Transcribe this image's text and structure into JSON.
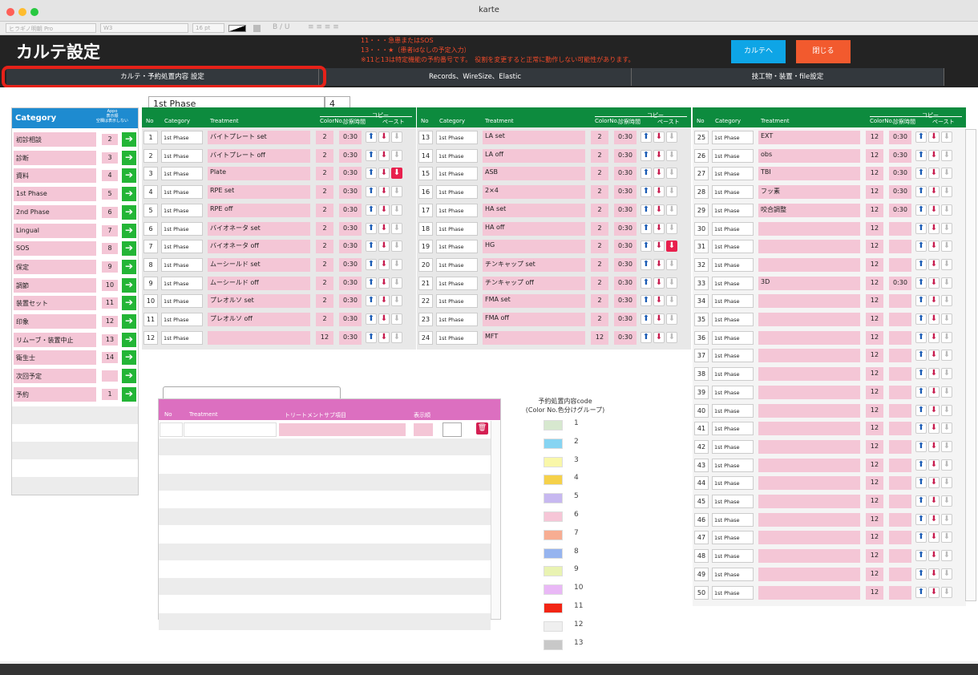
{
  "window": {
    "title": "karte"
  },
  "format_bar": {
    "font": "ヒラギノ明朝 Pro",
    "style": "W3",
    "size": "16 pt",
    "text_buttons": "B / U"
  },
  "header": {
    "title": "カルテ設定",
    "notes": [
      "11・・・急患またはSOS",
      "13・・・★（患者idなしの予定入力）",
      "※11と13は特定機能の予約番号です。　役割を変更すると正常に動作しない可能性があります。"
    ],
    "karte_button": "カルテへ",
    "close_button": "閉じる",
    "button_colors": {
      "karte": "#0ea5e6",
      "close": "#f25a2e"
    }
  },
  "tabs": [
    "カルテ・予約処置内容 設定",
    "Records、WireSize、Elastic",
    "技工物・装置・file設定"
  ],
  "category_panel": {
    "title": "Category",
    "col_header_line1": "Appo",
    "col_header_line2": "表示順",
    "col_header_line3": "空欄は表示しない",
    "items": [
      {
        "label": "初診相談",
        "order": "2"
      },
      {
        "label": "診断",
        "order": "3"
      },
      {
        "label": "資料",
        "order": "4"
      },
      {
        "label": "1st Phase",
        "order": "5"
      },
      {
        "label": "2nd Phase",
        "order": "6"
      },
      {
        "label": "Lingual",
        "order": "7"
      },
      {
        "label": "SOS",
        "order": "8"
      },
      {
        "label": "保定",
        "order": "9"
      },
      {
        "label": "調節",
        "order": "10"
      },
      {
        "label": "装置セット",
        "order": "11"
      },
      {
        "label": "印象",
        "order": "12"
      },
      {
        "label": "リムーブ・装置中止",
        "order": "13"
      },
      {
        "label": "衛生士",
        "order": "14"
      },
      {
        "label": "次回予定",
        "order": ""
      },
      {
        "label": "予約",
        "order": "1"
      }
    ]
  },
  "phase": {
    "name": "1st Phase",
    "number": "4"
  },
  "grid_headers": {
    "no": "No",
    "category": "Category",
    "treatment": "Treatment",
    "colorno": "ColorNo.",
    "time": "診察時間",
    "copy": "コピー",
    "paste": "ペースト"
  },
  "grid_columns": [
    [
      {
        "no": "1",
        "category": "1st Phase",
        "treatment": "バイトプレート set",
        "color": "2",
        "time": "0:30"
      },
      {
        "no": "2",
        "category": "1st Phase",
        "treatment": "バイトプレート off",
        "color": "2",
        "time": "0:30"
      },
      {
        "no": "3",
        "category": "1st Phase",
        "treatment": "Plate",
        "color": "2",
        "time": "0:30",
        "paste_red": true
      },
      {
        "no": "4",
        "category": "1st Phase",
        "treatment": "RPE set",
        "color": "2",
        "time": "0:30"
      },
      {
        "no": "5",
        "category": "1st Phase",
        "treatment": "RPE off",
        "color": "2",
        "time": "0:30"
      },
      {
        "no": "6",
        "category": "1st Phase",
        "treatment": "バイオネータ set",
        "color": "2",
        "time": "0:30"
      },
      {
        "no": "7",
        "category": "1st Phase",
        "treatment": "バイオネータ off",
        "color": "2",
        "time": "0:30"
      },
      {
        "no": "8",
        "category": "1st Phase",
        "treatment": "ムーシールド set",
        "color": "2",
        "time": "0:30"
      },
      {
        "no": "9",
        "category": "1st Phase",
        "treatment": "ムーシールド off",
        "color": "2",
        "time": "0:30"
      },
      {
        "no": "10",
        "category": "1st Phase",
        "treatment": "プレオルソ set",
        "color": "2",
        "time": "0:30"
      },
      {
        "no": "11",
        "category": "1st Phase",
        "treatment": "プレオルソ off",
        "color": "2",
        "time": "0:30"
      },
      {
        "no": "12",
        "category": "1st Phase",
        "treatment": "",
        "color": "12",
        "time": "0:30"
      }
    ],
    [
      {
        "no": "13",
        "category": "1st Phase",
        "treatment": "LA set",
        "color": "2",
        "time": "0:30"
      },
      {
        "no": "14",
        "category": "1st Phase",
        "treatment": "LA off",
        "color": "2",
        "time": "0:30"
      },
      {
        "no": "15",
        "category": "1st Phase",
        "treatment": "ASB",
        "color": "2",
        "time": "0:30"
      },
      {
        "no": "16",
        "category": "1st Phase",
        "treatment": "2×4",
        "color": "2",
        "time": "0:30"
      },
      {
        "no": "17",
        "category": "1st Phase",
        "treatment": "HA set",
        "color": "2",
        "time": "0:30"
      },
      {
        "no": "18",
        "category": "1st Phase",
        "treatment": "HA off",
        "color": "2",
        "time": "0:30"
      },
      {
        "no": "19",
        "category": "1st Phase",
        "treatment": "HG",
        "color": "2",
        "time": "0:30",
        "paste_red": true
      },
      {
        "no": "20",
        "category": "1st Phase",
        "treatment": "チンキャップ set",
        "color": "2",
        "time": "0:30"
      },
      {
        "no": "21",
        "category": "1st Phase",
        "treatment": "チンキャップ off",
        "color": "2",
        "time": "0:30"
      },
      {
        "no": "22",
        "category": "1st Phase",
        "treatment": "FMA set",
        "color": "2",
        "time": "0:30"
      },
      {
        "no": "23",
        "category": "1st Phase",
        "treatment": "FMA off",
        "color": "2",
        "time": "0:30"
      },
      {
        "no": "24",
        "category": "1st Phase",
        "treatment": "MFT",
        "color": "12",
        "time": "0:30"
      }
    ],
    [
      {
        "no": "25",
        "category": "1st Phase",
        "treatment": "EXT",
        "color": "12",
        "time": "0:30"
      },
      {
        "no": "26",
        "category": "1st Phase",
        "treatment": "obs",
        "color": "12",
        "time": "0:30"
      },
      {
        "no": "27",
        "category": "1st Phase",
        "treatment": "TBI",
        "color": "12",
        "time": "0:30"
      },
      {
        "no": "28",
        "category": "1st Phase",
        "treatment": "フッ素",
        "color": "12",
        "time": "0:30"
      },
      {
        "no": "29",
        "category": "1st Phase",
        "treatment": "咬合調整",
        "color": "12",
        "time": "0:30"
      },
      {
        "no": "30",
        "category": "1st Phase",
        "treatment": "",
        "color": "12",
        "time": ""
      },
      {
        "no": "31",
        "category": "1st Phase",
        "treatment": "",
        "color": "12",
        "time": ""
      },
      {
        "no": "32",
        "category": "1st Phase",
        "treatment": "",
        "color": "12",
        "time": ""
      },
      {
        "no": "33",
        "category": "1st Phase",
        "treatment": "3D",
        "color": "12",
        "time": "0:30"
      },
      {
        "no": "34",
        "category": "1st Phase",
        "treatment": "",
        "color": "12",
        "time": ""
      },
      {
        "no": "35",
        "category": "1st Phase",
        "treatment": "",
        "color": "12",
        "time": ""
      },
      {
        "no": "36",
        "category": "1st Phase",
        "treatment": "",
        "color": "12",
        "time": ""
      },
      {
        "no": "37",
        "category": "1st Phase",
        "treatment": "",
        "color": "12",
        "time": ""
      },
      {
        "no": "38",
        "category": "1st Phase",
        "treatment": "",
        "color": "12",
        "time": ""
      },
      {
        "no": "39",
        "category": "1st Phase",
        "treatment": "",
        "color": "12",
        "time": ""
      },
      {
        "no": "40",
        "category": "1st Phase",
        "treatment": "",
        "color": "12",
        "time": ""
      },
      {
        "no": "41",
        "category": "1st Phase",
        "treatment": "",
        "color": "12",
        "time": ""
      },
      {
        "no": "42",
        "category": "1st Phase",
        "treatment": "",
        "color": "12",
        "time": ""
      },
      {
        "no": "43",
        "category": "1st Phase",
        "treatment": "",
        "color": "12",
        "time": ""
      },
      {
        "no": "44",
        "category": "1st Phase",
        "treatment": "",
        "color": "12",
        "time": ""
      },
      {
        "no": "45",
        "category": "1st Phase",
        "treatment": "",
        "color": "12",
        "time": ""
      },
      {
        "no": "46",
        "category": "1st Phase",
        "treatment": "",
        "color": "12",
        "time": ""
      },
      {
        "no": "47",
        "category": "1st Phase",
        "treatment": "",
        "color": "12",
        "time": ""
      },
      {
        "no": "48",
        "category": "1st Phase",
        "treatment": "",
        "color": "12",
        "time": ""
      },
      {
        "no": "49",
        "category": "1st Phase",
        "treatment": "",
        "color": "12",
        "time": ""
      },
      {
        "no": "50",
        "category": "1st Phase",
        "treatment": "",
        "color": "12",
        "time": ""
      }
    ]
  ],
  "sub_panel": {
    "search_value": "",
    "headers": {
      "no": "No",
      "treatment": "Treatment",
      "sub": "トリートメントサブ項目",
      "order": "表示順"
    }
  },
  "legend": {
    "title_line1": "予約処置内容code",
    "title_line2": "(Color No.色分けグループ)",
    "items": [
      {
        "n": "1",
        "color": "#d7e8cf"
      },
      {
        "n": "2",
        "color": "#86d4f2"
      },
      {
        "n": "3",
        "color": "#f9f7a9"
      },
      {
        "n": "4",
        "color": "#f5d14a"
      },
      {
        "n": "5",
        "color": "#c7b8f0"
      },
      {
        "n": "6",
        "color": "#f6c6d7"
      },
      {
        "n": "7",
        "color": "#f7ad92"
      },
      {
        "n": "8",
        "color": "#96b4ef"
      },
      {
        "n": "9",
        "color": "#e9f3b2"
      },
      {
        "n": "10",
        "color": "#e9b8f6"
      },
      {
        "n": "11",
        "color": "#f22514"
      },
      {
        "n": "12",
        "color": "#efefef"
      },
      {
        "n": "13",
        "color": "#c8c8c8"
      }
    ]
  }
}
